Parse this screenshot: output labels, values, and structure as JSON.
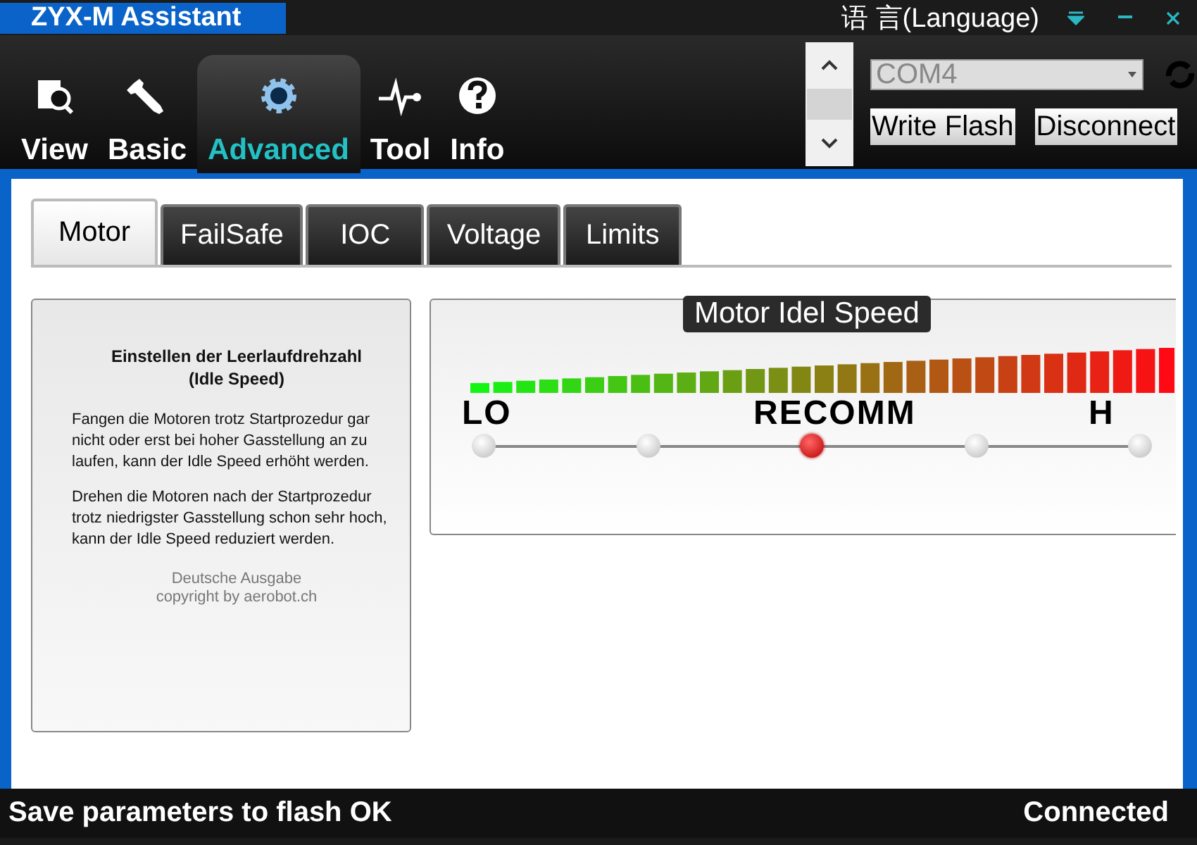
{
  "window": {
    "title": "ZYX-M Assistant",
    "language": "语 言(Language)"
  },
  "toolbar": [
    {
      "label": "View",
      "selected": false
    },
    {
      "label": "Basic",
      "selected": false
    },
    {
      "label": "Advanced",
      "selected": true
    },
    {
      "label": "Tool",
      "selected": false
    },
    {
      "label": "Info",
      "selected": false
    }
  ],
  "connection": {
    "port": "COM4",
    "buttons": [
      "Write Flash",
      "Disconnect"
    ]
  },
  "tabs": [
    {
      "label": "Motor",
      "selected": true
    },
    {
      "label": "FailSafe",
      "selected": false
    },
    {
      "label": "IOC",
      "selected": false
    },
    {
      "label": "Voltage",
      "selected": false
    },
    {
      "label": "Limits",
      "selected": false
    }
  ],
  "help": {
    "title": "Einstellen der Leerlaufdrehzahl (Idle Speed)",
    "paragraphs": [
      "Fangen die Motoren trotz Startprozedur gar nicht oder erst bei hoher Gasstellung an zu laufen, kann der Idle Speed erhöht werden.",
      "Drehen die Motoren nach der Startprozedur trotz niedrigster Gasstellung schon sehr hoch, kann der Idle Speed reduziert werden."
    ],
    "footer": [
      "Deutsche Ausgabe",
      "copyright by aerobot.ch"
    ]
  },
  "setting": {
    "title": "Motor Idel Speed",
    "labels": [
      "LO",
      "RECOMM",
      "H"
    ],
    "stops": [
      {
        "selected": false
      },
      {
        "selected": false
      },
      {
        "selected": true
      },
      {
        "selected": false
      },
      {
        "selected": false
      }
    ]
  },
  "status_bar": {
    "message": "Save parameters to flash OK",
    "state": "Connected"
  }
}
